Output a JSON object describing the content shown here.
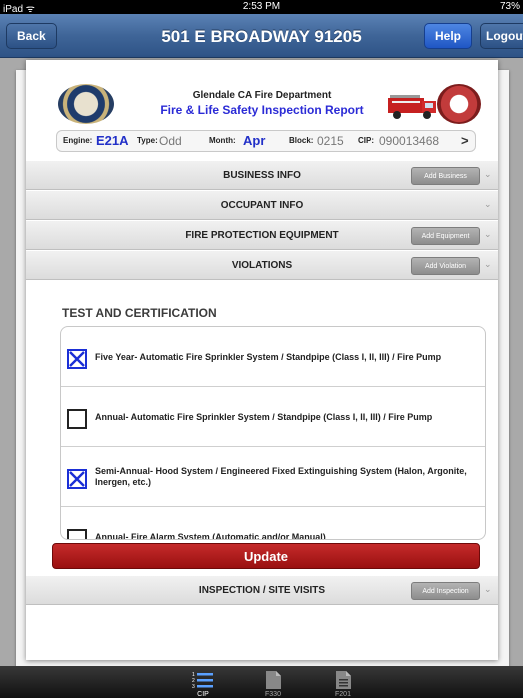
{
  "status_bar": {
    "carrier": "iPad ᯤ",
    "time": "2:53 PM",
    "battery": "73%"
  },
  "nav": {
    "title": "501 E BROADWAY 91205",
    "back_label": "Back",
    "help_label": "Help",
    "logout_label": "Logout"
  },
  "header": {
    "department": "Glendale CA Fire Department",
    "report_title": "Fire & Life Safety Inspection Report",
    "engine_label": "Engine:",
    "engine_value": "E21A",
    "type_label": "Type:",
    "type_value": "Odd",
    "month_label": "Month:",
    "month_value": "Apr",
    "block_label": "Block:",
    "block_value": "0215",
    "cip_label": "CIP:",
    "cip_value": "090013468",
    "chevron": ">"
  },
  "sections": [
    {
      "title": "BUSINESS INFO",
      "button": "Add Business"
    },
    {
      "title": "OCCUPANT INFO",
      "button": ""
    },
    {
      "title": "FIRE PROTECTION EQUIPMENT",
      "button": "Add Equipment"
    },
    {
      "title": "VIOLATIONS",
      "button": "Add Violation"
    }
  ],
  "test_certification": {
    "title": "TEST AND CERTIFICATION",
    "items": [
      {
        "text": "Five Year- Automatic Fire Sprinkler System / Standpipe (Class I, II, III) / Fire Pump",
        "checked": true
      },
      {
        "text": "Annual- Automatic Fire Sprinkler System / Standpipe (Class I, II, III) / Fire Pump",
        "checked": false
      },
      {
        "text": "Semi-Annual- Hood System / Engineered Fixed Extinguishing System (Halon, Argonite, Inergen, etc.)",
        "checked": true
      },
      {
        "text": "Annual- Fire Alarm System (Automatic and/or Manual)",
        "checked": false
      }
    ],
    "update_label": "Update"
  },
  "inspection_section": {
    "title": "INSPECTION / SITE VISITS",
    "button": "Add Inspection"
  },
  "tabs": [
    {
      "label": "CIP",
      "icon": "list-icon",
      "active": true
    },
    {
      "label": "F330",
      "icon": "document-icon",
      "active": false
    },
    {
      "label": "F201",
      "icon": "document-lines-icon",
      "active": false
    }
  ],
  "colors": {
    "nav_blue": "#3f6598",
    "help_blue": "#2e63d0",
    "update_red": "#b21c1c",
    "check_blue": "#1b2fd6"
  }
}
